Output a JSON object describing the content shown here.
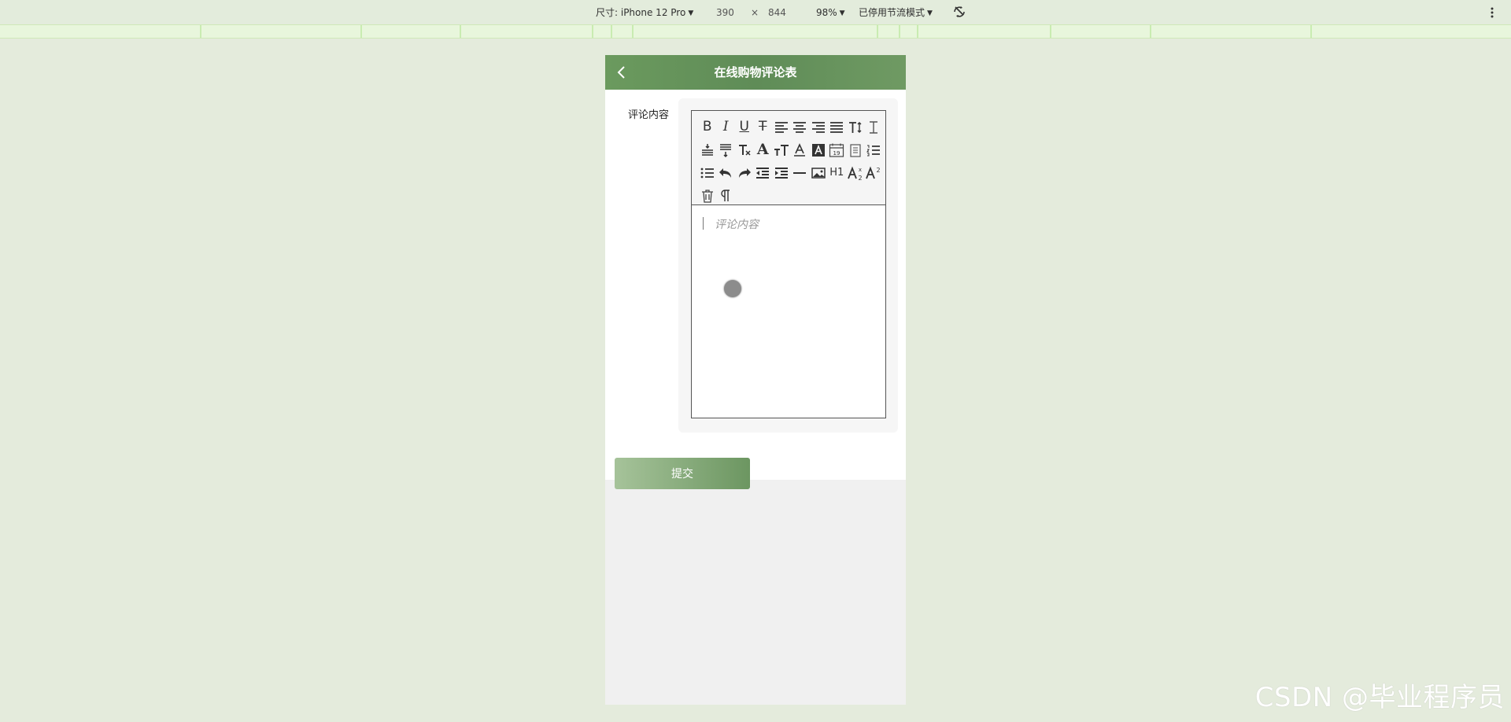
{
  "devtools": {
    "device_label": "尺寸: iPhone 12 Pro",
    "width": "390",
    "times": "×",
    "height": "844",
    "zoom": "98%",
    "throttle": "已停用节流模式"
  },
  "page": {
    "title": "在线购物评论表",
    "field_label": "评论内容",
    "placeholder": "评论内容",
    "submit_label": "提交"
  },
  "toolbar": {
    "rows": [
      [
        "bold",
        "italic",
        "underline",
        "strikethrough",
        "align-left",
        "align-center",
        "align-right",
        "align-justify",
        "font-size",
        "line-height"
      ],
      [
        "paragraph-spacing-top",
        "paragraph-spacing-bottom",
        "remove-format",
        "font-family",
        "font-size-grow",
        "fore-color",
        "back-color",
        "date",
        "template",
        "ordered-list"
      ],
      [
        "unordered-list",
        "undo",
        "redo",
        "indent",
        "outdent",
        "horizontal-rule",
        "image",
        "heading",
        "subscript",
        "superscript"
      ],
      [
        "clear",
        "paragraph"
      ]
    ]
  },
  "watermark": "CSDN @毕业程序员",
  "colors": {
    "header": "#6b9a5e",
    "page_bg": "#e4ebdc",
    "button_gradient": [
      "#a6c39a",
      "#6c9661"
    ]
  }
}
